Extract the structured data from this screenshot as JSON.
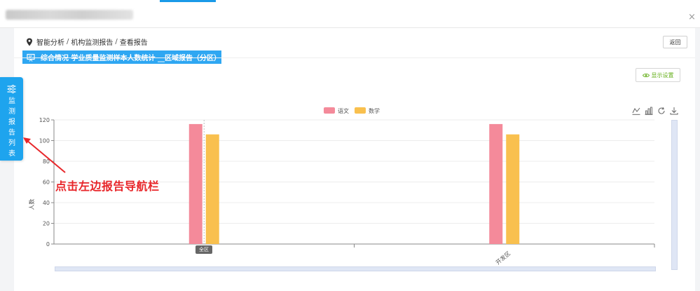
{
  "window": {
    "close_icon": "close-icon",
    "close_glyph": "×"
  },
  "breadcrumb": {
    "items": [
      "智能分析",
      "机构监测报告",
      "查看报告"
    ],
    "separator": "/"
  },
  "back_button": {
    "label": "返回"
  },
  "report_banner": {
    "title": "综合情况 学业质量监测样本人数统计 __区域报告（分区）"
  },
  "display_settings": {
    "label": "显示设置"
  },
  "side_tab": {
    "label": "监测报告列表"
  },
  "annotation": {
    "text": "点击左边报告导航栏",
    "color": "#e8262a"
  },
  "tooltip": {
    "text": "全区"
  },
  "colors": {
    "accent": "#1ea4ee",
    "banner": "#2fa7f2",
    "series_chinese": "#f48a9a",
    "series_math": "#f9c04e",
    "settings_green": "#67b01e"
  },
  "toolbox": [
    "line-chart-icon",
    "bar-chart-icon",
    "restore-icon",
    "download-icon"
  ],
  "chart_data": {
    "type": "bar",
    "categories": [
      "全区",
      "开发区"
    ],
    "series": [
      {
        "name": "语文",
        "values": [
          116,
          116
        ],
        "color": "#f48a9a"
      },
      {
        "name": "数学",
        "values": [
          106,
          106
        ],
        "color": "#f9c04e"
      }
    ],
    "ylabel": "人数",
    "ylim": [
      0,
      120
    ],
    "yticks": [
      0,
      20,
      40,
      60,
      80,
      100,
      120
    ],
    "grid": true,
    "legend_position": "top-center"
  }
}
